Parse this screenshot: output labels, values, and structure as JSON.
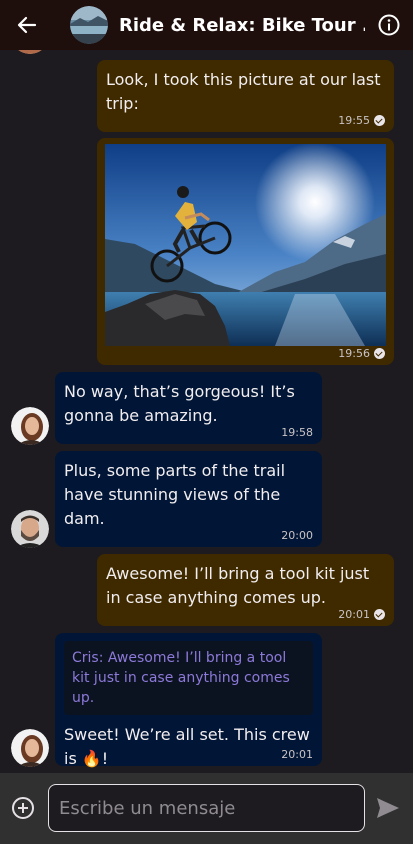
{
  "header": {
    "title": "Ride & Relax: Bike Tour ...",
    "back_icon": "arrow-back-icon",
    "info_icon": "info-icon"
  },
  "messages": [
    {
      "direction": "outgoing",
      "text": "Look, I took this picture at our last trip:",
      "time": "19:55",
      "status": "read"
    },
    {
      "direction": "outgoing",
      "type": "image",
      "time": "19:56",
      "status": "read"
    },
    {
      "direction": "incoming",
      "text": "No way, that’s gorgeous! It’s gonna be amazing.",
      "time": "19:58"
    },
    {
      "direction": "incoming",
      "text": "Plus, some parts of the trail have stunning views of the dam.",
      "time": "20:00"
    },
    {
      "direction": "outgoing",
      "text": "Awesome! I’ll bring a tool kit just in case anything comes up.",
      "time": "20:01",
      "status": "read"
    },
    {
      "direction": "incoming",
      "quote": "Cris: Awesome! I’ll bring a tool kit just in case anything comes up.",
      "text": "Sweet! We’re all set. This crew is 🔥!",
      "time": "20:01"
    }
  ],
  "composer": {
    "placeholder": "Escribe un mensaje",
    "value": "",
    "add_icon": "add-circle-icon",
    "send_icon": "send-icon"
  },
  "colors": {
    "appbar": "#1f0f0c",
    "background": "#1d1b1f",
    "outgoing_bubble": "#3f2a00",
    "incoming_bubble": "#011636",
    "quote_text": "#8c79d9",
    "composer": "#303031"
  }
}
